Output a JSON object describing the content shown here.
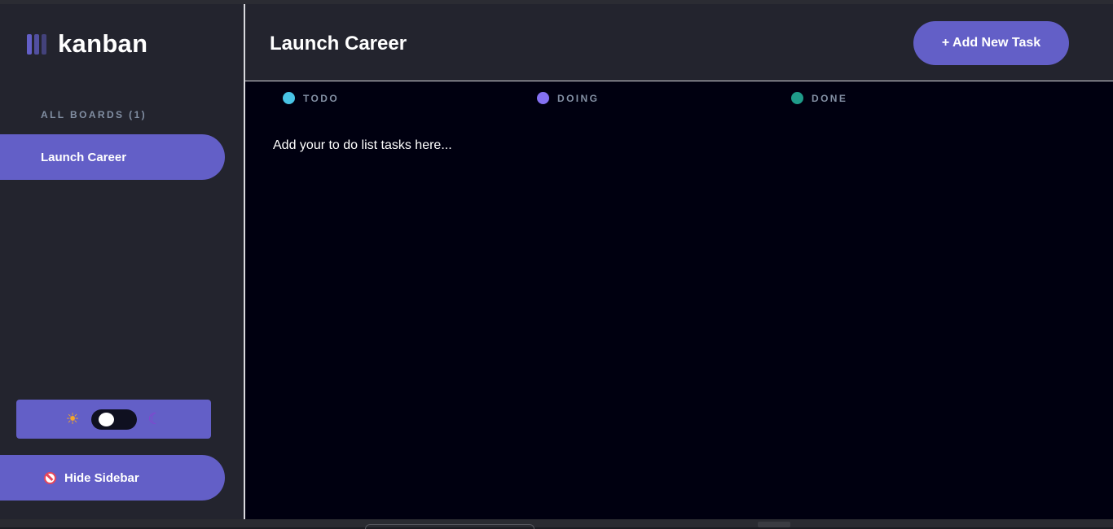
{
  "app": {
    "name": "kanban"
  },
  "sidebar": {
    "heading": "ALL BOARDS (1)",
    "boards": [
      {
        "label": "Launch Career",
        "active": true
      }
    ],
    "theme_toggle": {
      "light_icon": "sun-face-emoji",
      "dark_icon": "moon-face-emoji",
      "mode": "dark"
    },
    "hide_label": "Hide Sidebar",
    "hide_icon": "no-entry-icon"
  },
  "header": {
    "title": "Launch Career",
    "add_task_label": "+ Add New Task"
  },
  "columns": [
    {
      "name": "TODO",
      "color": "#49c4e5"
    },
    {
      "name": "DOING",
      "color": "#8471f2"
    },
    {
      "name": "DONE",
      "color": "#1f9c8a"
    }
  ],
  "main": {
    "empty_message": "Add your to do list tasks here..."
  },
  "colors": {
    "accent": "#635fc7",
    "sidebar_bg": "#23242e",
    "board_bg": "#000010"
  }
}
